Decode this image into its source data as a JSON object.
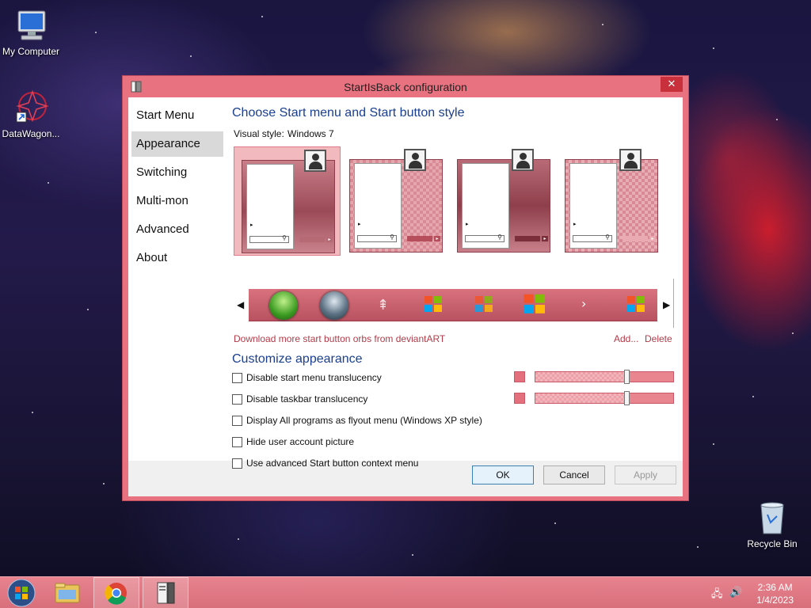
{
  "desktop": {
    "icons": [
      {
        "label": "My Computer",
        "icon": "computer-icon"
      },
      {
        "label": "DataWagon...",
        "icon": "datawagon-shortcut-icon"
      },
      {
        "label": "Recycle Bin",
        "icon": "recycle-bin-icon"
      }
    ]
  },
  "dialog": {
    "title": "StartIsBack configuration",
    "close_glyph": "✕",
    "nav": [
      {
        "label": "Start Menu"
      },
      {
        "label": "Appearance"
      },
      {
        "label": "Switching"
      },
      {
        "label": "Multi-mon"
      },
      {
        "label": "Advanced"
      },
      {
        "label": "About"
      }
    ],
    "active_nav": "Appearance",
    "section1_title": "Choose Start menu and Start button style",
    "visual_style_label": "Visual style:",
    "visual_style_value": "Windows 7",
    "orbs_link": "Download more start button orbs from deviantART",
    "add_link": "Add...",
    "delete_link": "Delete",
    "section2_title": "Customize appearance",
    "options": [
      {
        "label": "Disable start menu translucency",
        "checked": false
      },
      {
        "label": "Disable taskbar translucency",
        "checked": false
      },
      {
        "label": "Display All programs as flyout menu (Windows XP style)",
        "checked": false
      },
      {
        "label": "Hide user account picture",
        "checked": false
      },
      {
        "label": "Use advanced Start button context menu",
        "checked": false
      }
    ],
    "translucency_sliders": [
      0.66,
      0.66
    ],
    "buttons": {
      "ok": "OK",
      "cancel": "Cancel",
      "apply": "Apply"
    },
    "colors": {
      "accent": "#e8727f",
      "heading": "#1a3f8f",
      "link": "#b23a48"
    }
  },
  "taskbar": {
    "time": "2:36 AM",
    "date": "1/4/2023",
    "items": [
      "start-orb-icon",
      "file-explorer-icon",
      "chrome-icon",
      "startisback-config-icon"
    ]
  }
}
